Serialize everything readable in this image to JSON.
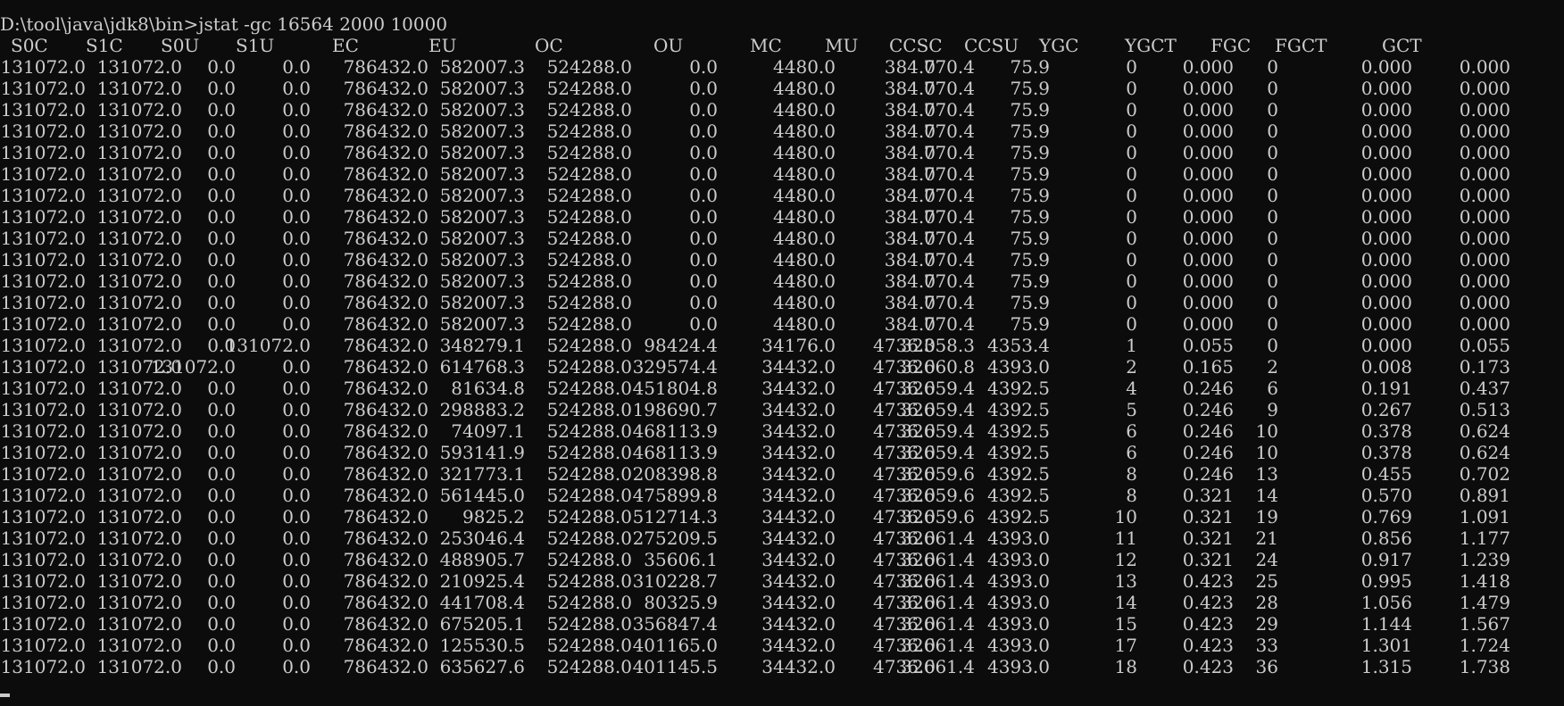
{
  "terminal": {
    "prompt": "D:\\tool\\java\\jdk8\\bin>jstat -gc 16564 2000 10000",
    "columns": [
      "S0C",
      "S1C",
      "S0U",
      "S1U",
      "EC",
      "EU",
      "OC",
      "OU",
      "MC",
      "MU",
      "CCSC",
      "CCSU",
      "YGC",
      "YGCT",
      "FGC",
      "FGCT",
      "GCT"
    ],
    "rows": [
      [
        "131072.0",
        "131072.0",
        "0.0",
        "0.0",
        "786432.0",
        "582007.3",
        "524288.0",
        "0.0",
        "4480.0",
        "770.4",
        "384.0",
        "75.9",
        "0",
        "0.000",
        "0",
        "0.000",
        "0.000"
      ],
      [
        "131072.0",
        "131072.0",
        "0.0",
        "0.0",
        "786432.0",
        "582007.3",
        "524288.0",
        "0.0",
        "4480.0",
        "770.4",
        "384.0",
        "75.9",
        "0",
        "0.000",
        "0",
        "0.000",
        "0.000"
      ],
      [
        "131072.0",
        "131072.0",
        "0.0",
        "0.0",
        "786432.0",
        "582007.3",
        "524288.0",
        "0.0",
        "4480.0",
        "770.4",
        "384.0",
        "75.9",
        "0",
        "0.000",
        "0",
        "0.000",
        "0.000"
      ],
      [
        "131072.0",
        "131072.0",
        "0.0",
        "0.0",
        "786432.0",
        "582007.3",
        "524288.0",
        "0.0",
        "4480.0",
        "770.4",
        "384.0",
        "75.9",
        "0",
        "0.000",
        "0",
        "0.000",
        "0.000"
      ],
      [
        "131072.0",
        "131072.0",
        "0.0",
        "0.0",
        "786432.0",
        "582007.3",
        "524288.0",
        "0.0",
        "4480.0",
        "770.4",
        "384.0",
        "75.9",
        "0",
        "0.000",
        "0",
        "0.000",
        "0.000"
      ],
      [
        "131072.0",
        "131072.0",
        "0.0",
        "0.0",
        "786432.0",
        "582007.3",
        "524288.0",
        "0.0",
        "4480.0",
        "770.4",
        "384.0",
        "75.9",
        "0",
        "0.000",
        "0",
        "0.000",
        "0.000"
      ],
      [
        "131072.0",
        "131072.0",
        "0.0",
        "0.0",
        "786432.0",
        "582007.3",
        "524288.0",
        "0.0",
        "4480.0",
        "770.4",
        "384.0",
        "75.9",
        "0",
        "0.000",
        "0",
        "0.000",
        "0.000"
      ],
      [
        "131072.0",
        "131072.0",
        "0.0",
        "0.0",
        "786432.0",
        "582007.3",
        "524288.0",
        "0.0",
        "4480.0",
        "770.4",
        "384.0",
        "75.9",
        "0",
        "0.000",
        "0",
        "0.000",
        "0.000"
      ],
      [
        "131072.0",
        "131072.0",
        "0.0",
        "0.0",
        "786432.0",
        "582007.3",
        "524288.0",
        "0.0",
        "4480.0",
        "770.4",
        "384.0",
        "75.9",
        "0",
        "0.000",
        "0",
        "0.000",
        "0.000"
      ],
      [
        "131072.0",
        "131072.0",
        "0.0",
        "0.0",
        "786432.0",
        "582007.3",
        "524288.0",
        "0.0",
        "4480.0",
        "770.4",
        "384.0",
        "75.9",
        "0",
        "0.000",
        "0",
        "0.000",
        "0.000"
      ],
      [
        "131072.0",
        "131072.0",
        "0.0",
        "0.0",
        "786432.0",
        "582007.3",
        "524288.0",
        "0.0",
        "4480.0",
        "770.4",
        "384.0",
        "75.9",
        "0",
        "0.000",
        "0",
        "0.000",
        "0.000"
      ],
      [
        "131072.0",
        "131072.0",
        "0.0",
        "0.0",
        "786432.0",
        "582007.3",
        "524288.0",
        "0.0",
        "4480.0",
        "770.4",
        "384.0",
        "75.9",
        "0",
        "0.000",
        "0",
        "0.000",
        "0.000"
      ],
      [
        "131072.0",
        "131072.0",
        "0.0",
        "0.0",
        "786432.0",
        "582007.3",
        "524288.0",
        "0.0",
        "4480.0",
        "770.4",
        "384.0",
        "75.9",
        "0",
        "0.000",
        "0",
        "0.000",
        "0.000"
      ],
      [
        "131072.0",
        "131072.0",
        "0.0",
        "131072.0",
        "786432.0",
        "348279.1",
        "524288.0",
        "98424.4",
        "34176.0",
        "32358.3",
        "4736.0",
        "4353.4",
        "1",
        "0.055",
        "0",
        "0.000",
        "0.055"
      ],
      [
        "131072.0",
        "131072.0",
        "131072.0",
        "0.0",
        "786432.0",
        "614768.3",
        "524288.0",
        "329574.4",
        "34432.0",
        "32660.8",
        "4736.0",
        "4393.0",
        "2",
        "0.165",
        "2",
        "0.008",
        "0.173"
      ],
      [
        "131072.0",
        "131072.0",
        "0.0",
        "0.0",
        "786432.0",
        "81634.8",
        "524288.0",
        "451804.8",
        "34432.0",
        "32659.4",
        "4736.0",
        "4392.5",
        "4",
        "0.246",
        "6",
        "0.191",
        "0.437"
      ],
      [
        "131072.0",
        "131072.0",
        "0.0",
        "0.0",
        "786432.0",
        "298883.2",
        "524288.0",
        "198690.7",
        "34432.0",
        "32659.4",
        "4736.0",
        "4392.5",
        "5",
        "0.246",
        "9",
        "0.267",
        "0.513"
      ],
      [
        "131072.0",
        "131072.0",
        "0.0",
        "0.0",
        "786432.0",
        "74097.1",
        "524288.0",
        "468113.9",
        "34432.0",
        "32659.4",
        "4736.0",
        "4392.5",
        "6",
        "0.246",
        "10",
        "0.378",
        "0.624"
      ],
      [
        "131072.0",
        "131072.0",
        "0.0",
        "0.0",
        "786432.0",
        "593141.9",
        "524288.0",
        "468113.9",
        "34432.0",
        "32659.4",
        "4736.0",
        "4392.5",
        "6",
        "0.246",
        "10",
        "0.378",
        "0.624"
      ],
      [
        "131072.0",
        "131072.0",
        "0.0",
        "0.0",
        "786432.0",
        "321773.1",
        "524288.0",
        "208398.8",
        "34432.0",
        "32659.6",
        "4736.0",
        "4392.5",
        "8",
        "0.246",
        "13",
        "0.455",
        "0.702"
      ],
      [
        "131072.0",
        "131072.0",
        "0.0",
        "0.0",
        "786432.0",
        "561445.0",
        "524288.0",
        "475899.8",
        "34432.0",
        "32659.6",
        "4736.0",
        "4392.5",
        "8",
        "0.321",
        "14",
        "0.570",
        "0.891"
      ],
      [
        "131072.0",
        "131072.0",
        "0.0",
        "0.0",
        "786432.0",
        "9825.2",
        "524288.0",
        "512714.3",
        "34432.0",
        "32659.6",
        "4736.0",
        "4392.5",
        "10",
        "0.321",
        "19",
        "0.769",
        "1.091"
      ],
      [
        "131072.0",
        "131072.0",
        "0.0",
        "0.0",
        "786432.0",
        "253046.4",
        "524288.0",
        "275209.5",
        "34432.0",
        "32661.4",
        "4736.0",
        "4393.0",
        "11",
        "0.321",
        "21",
        "0.856",
        "1.177"
      ],
      [
        "131072.0",
        "131072.0",
        "0.0",
        "0.0",
        "786432.0",
        "488905.7",
        "524288.0",
        "35606.1",
        "34432.0",
        "32661.4",
        "4736.0",
        "4393.0",
        "12",
        "0.321",
        "24",
        "0.917",
        "1.239"
      ],
      [
        "131072.0",
        "131072.0",
        "0.0",
        "0.0",
        "786432.0",
        "210925.4",
        "524288.0",
        "310228.7",
        "34432.0",
        "32661.4",
        "4736.0",
        "4393.0",
        "13",
        "0.423",
        "25",
        "0.995",
        "1.418"
      ],
      [
        "131072.0",
        "131072.0",
        "0.0",
        "0.0",
        "786432.0",
        "441708.4",
        "524288.0",
        "80325.9",
        "34432.0",
        "32661.4",
        "4736.0",
        "4393.0",
        "14",
        "0.423",
        "28",
        "1.056",
        "1.479"
      ],
      [
        "131072.0",
        "131072.0",
        "0.0",
        "0.0",
        "786432.0",
        "675205.1",
        "524288.0",
        "356847.4",
        "34432.0",
        "32661.4",
        "4736.0",
        "4393.0",
        "15",
        "0.423",
        "29",
        "1.144",
        "1.567"
      ],
      [
        "131072.0",
        "131072.0",
        "0.0",
        "0.0",
        "786432.0",
        "125530.5",
        "524288.0",
        "401165.0",
        "34432.0",
        "32661.4",
        "4736.0",
        "4393.0",
        "17",
        "0.423",
        "33",
        "1.301",
        "1.724"
      ],
      [
        "131072.0",
        "131072.0",
        "0.0",
        "0.0",
        "786432.0",
        "635627.6",
        "524288.0",
        "401145.5",
        "34432.0",
        "32661.4",
        "4736.0",
        "4393.0",
        "18",
        "0.423",
        "36",
        "1.315",
        "1.738"
      ]
    ]
  },
  "colors": {
    "background": "#0c0c0c",
    "foreground": "#cccccc"
  }
}
